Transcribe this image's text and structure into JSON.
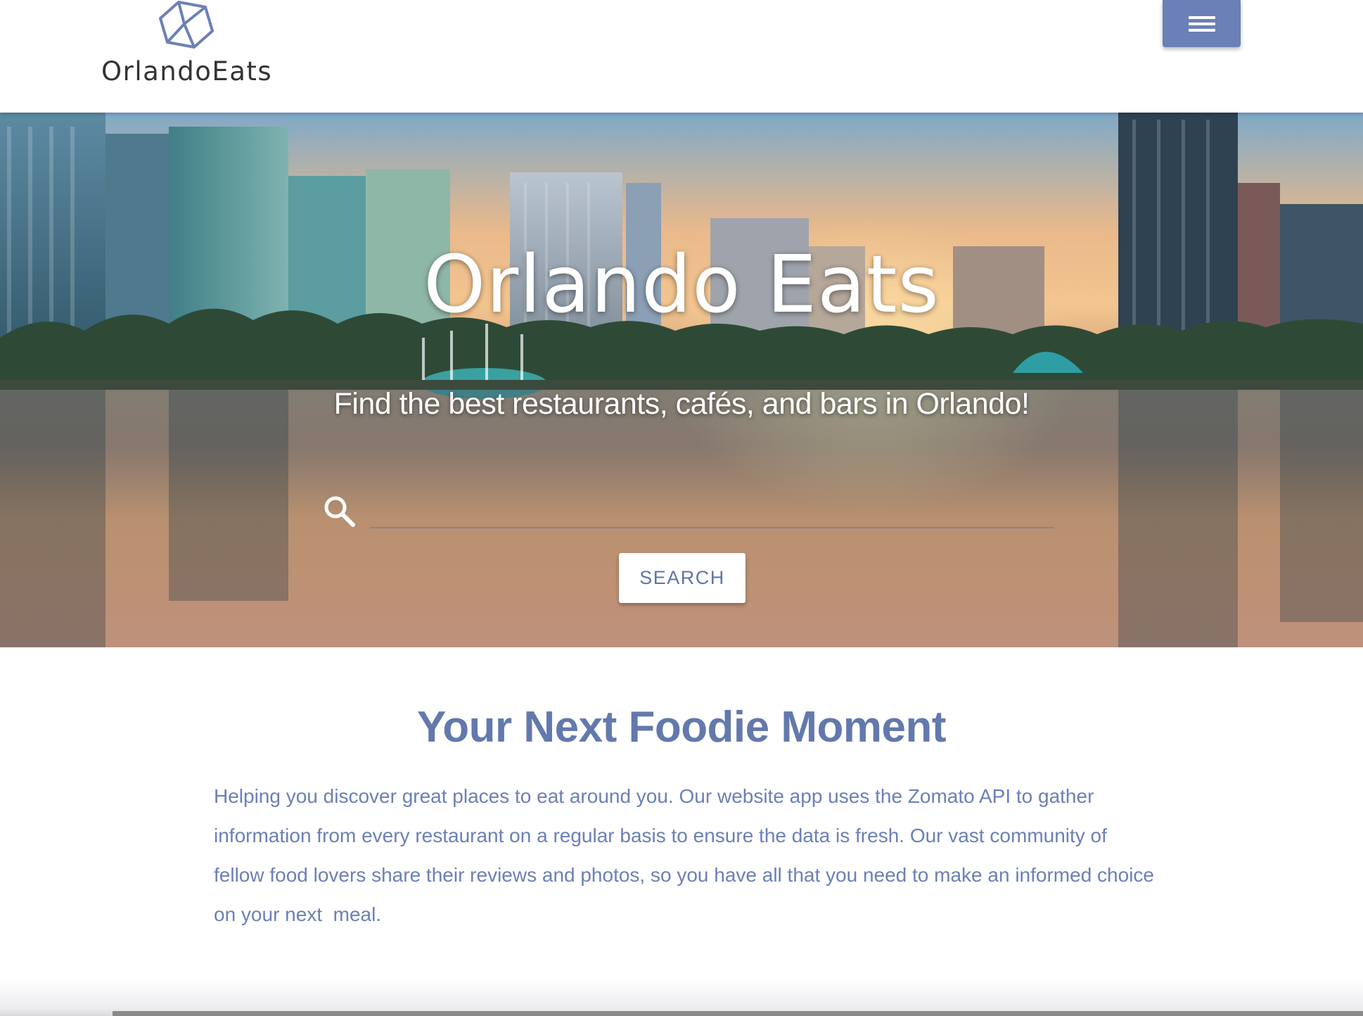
{
  "header": {
    "brand_name": "OrlandoEats",
    "brand_icon": "cube-logo-icon",
    "menu_icon": "hamburger-menu-icon"
  },
  "hero": {
    "title": "Orlando Eats",
    "subtitle": "Find the best restaurants, cafés, and bars in Orlando!",
    "search": {
      "icon": "search-icon",
      "value": "",
      "placeholder": ""
    },
    "search_button_label": "SEARCH"
  },
  "about": {
    "title": "Your Next Foodie Moment",
    "text": "Helping you discover great places to eat around you. Our website app uses the Zomato API to gather information from every restaurant on a regular basis to ensure the data is fresh. Our vast community of fellow food lovers share their reviews and photos, so you have all that you need to make an informed choice on your next  meal."
  },
  "colors": {
    "accent": "#6b80b6",
    "heading": "#6379ad",
    "header_bg": "#ffffff"
  }
}
